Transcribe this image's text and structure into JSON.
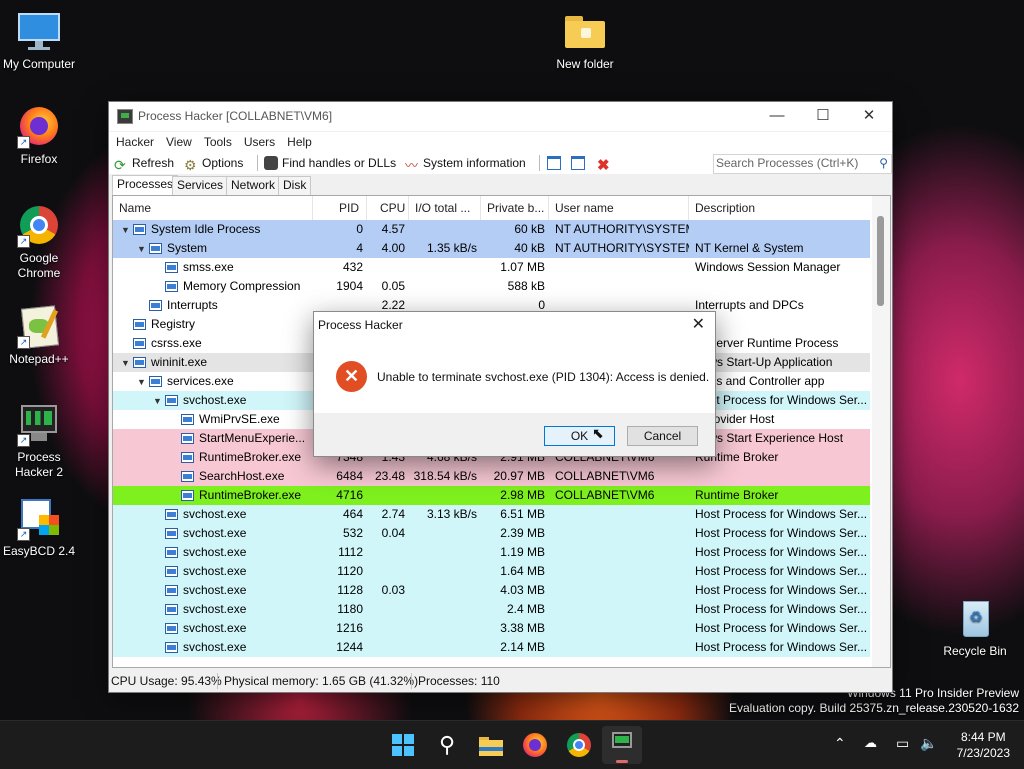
{
  "desktop": {
    "icons": [
      {
        "label": "My Computer",
        "icon": "monitor-icon"
      },
      {
        "label": "New folder",
        "icon": "folder-icon"
      },
      {
        "label": "Firefox",
        "icon": "firefox-icon"
      },
      {
        "label": "Google\nChrome",
        "icon": "chrome-icon"
      },
      {
        "label": "Notepad++",
        "icon": "notepadpp-icon"
      },
      {
        "label": "Process\nHacker 2",
        "icon": "process-hacker-icon"
      },
      {
        "label": "EasyBCD 2.4",
        "icon": "easybcd-icon"
      },
      {
        "label": "Recycle Bin",
        "icon": "recycle-bin-icon"
      }
    ],
    "watermark": {
      "line1": "Windows 11 Pro Insider Preview",
      "line2": "Evaluation copy. Build 25375.zn_release.230520-1632"
    }
  },
  "window": {
    "title": "Process Hacker [COLLABNET\\VM6]",
    "menu": [
      "Hacker",
      "View",
      "Tools",
      "Users",
      "Help"
    ],
    "toolbar": {
      "refresh": "Refresh",
      "options": "Options",
      "find_handles": "Find handles or DLLs",
      "system_information": "System information"
    },
    "search_placeholder": "Search Processes (Ctrl+K)",
    "tabs": [
      "Processes",
      "Services",
      "Network",
      "Disk"
    ],
    "columns": [
      "Name",
      "PID",
      "CPU",
      "I/O total ...",
      "Private b...",
      "User name",
      "Description"
    ],
    "rows": [
      {
        "indent": 0,
        "exp": "v",
        "name": "System Idle Process",
        "pid": "0",
        "cpu": "4.57",
        "io": "",
        "priv": "60 kB",
        "user": "NT AUTHORITY\\SYSTEM",
        "desc": "",
        "bg": "#b3cdf5",
        "hidden": false
      },
      {
        "indent": 1,
        "exp": "v",
        "name": "System",
        "pid": "4",
        "cpu": "4.00",
        "io": "1.35 kB/s",
        "priv": "40 kB",
        "user": "NT AUTHORITY\\SYSTEM",
        "desc": "NT Kernel & System",
        "bg": "#b3cdf5",
        "hidden": false
      },
      {
        "indent": 2,
        "exp": "",
        "name": "smss.exe",
        "pid": "432",
        "cpu": "",
        "io": "",
        "priv": "1.07 MB",
        "user": "",
        "desc": "Windows Session Manager",
        "bg": "#ffffff",
        "hidden": false
      },
      {
        "indent": 2,
        "exp": "",
        "name": "Memory Compression",
        "pid": "1904",
        "cpu": "0.05",
        "io": "",
        "priv": "588 kB",
        "user": "",
        "desc": "",
        "bg": "#ffffff",
        "hidden": false
      },
      {
        "indent": 1,
        "exp": "",
        "name": "Interrupts",
        "pid": "",
        "cpu": "2.22",
        "io": "",
        "priv": "0",
        "user": "",
        "desc": "Interrupts and DPCs",
        "bg": "#ffffff",
        "hidden": false
      },
      {
        "indent": 0,
        "exp": "",
        "name": "Registry",
        "pid": "",
        "cpu": "",
        "io": "",
        "priv": "",
        "user": "",
        "desc": "",
        "bg": "#ffffff",
        "hidden": true
      },
      {
        "indent": 0,
        "exp": "",
        "name": "csrss.exe",
        "pid": "",
        "cpu": "",
        "io": "",
        "priv": "",
        "user": "",
        "desc": "nt Server Runtime Process",
        "bg": "#ffffff",
        "hidden": true
      },
      {
        "indent": 0,
        "exp": "v",
        "name": "wininit.exe",
        "pid": "",
        "cpu": "",
        "io": "",
        "priv": "",
        "user": "",
        "desc": "dows Start-Up Application",
        "bg": "#e4e4e4",
        "hidden": true
      },
      {
        "indent": 1,
        "exp": "v",
        "name": "services.exe",
        "pid": "",
        "cpu": "",
        "io": "",
        "priv": "",
        "user": "",
        "desc": "vices and Controller app",
        "bg": "#ffffff",
        "hidden": true
      },
      {
        "indent": 2,
        "exp": "v",
        "name": "svchost.exe",
        "pid": "",
        "cpu": "",
        "io": "",
        "priv": "",
        "user": "",
        "desc": "Host Process for Windows Ser...",
        "bg": "#d0f6fa",
        "hidden": true
      },
      {
        "indent": 3,
        "exp": "",
        "name": "WmiPrvSE.exe",
        "pid": "",
        "cpu": "",
        "io": "",
        "priv": "",
        "user": "",
        "desc": "I Provider Host",
        "bg": "#ffffff",
        "hidden": true
      },
      {
        "indent": 3,
        "exp": "",
        "name": "StartMenuExperie...",
        "pid": "",
        "cpu": "",
        "io": "",
        "priv": "",
        "user": "",
        "desc": "dows Start Experience Host",
        "bg": "#f7c8d4",
        "hidden": true
      },
      {
        "indent": 3,
        "exp": "",
        "name": "RuntimeBroker.exe",
        "pid": "7348",
        "cpu": "1.43",
        "io": "4.68 kB/s",
        "priv": "2.91 MB",
        "user": "COLLABNET\\VM6",
        "desc": "Runtime Broker",
        "bg": "#f7c8d4",
        "hidden": false
      },
      {
        "indent": 3,
        "exp": "",
        "name": "SearchHost.exe",
        "pid": "6484",
        "cpu": "23.48",
        "io": "318.54 kB/s",
        "priv": "20.97 MB",
        "user": "COLLABNET\\VM6",
        "desc": "",
        "bg": "#f7c8d4",
        "hidden": false
      },
      {
        "indent": 3,
        "exp": "",
        "name": "RuntimeBroker.exe",
        "pid": "4716",
        "cpu": "",
        "io": "",
        "priv": "2.98 MB",
        "user": "COLLABNET\\VM6",
        "desc": "Runtime Broker",
        "bg": "#7ef01e",
        "hidden": false
      },
      {
        "indent": 2,
        "exp": "",
        "name": "svchost.exe",
        "pid": "464",
        "cpu": "2.74",
        "io": "3.13 kB/s",
        "priv": "6.51 MB",
        "user": "",
        "desc": "Host Process for Windows Ser...",
        "bg": "#d0f6fa",
        "hidden": false
      },
      {
        "indent": 2,
        "exp": "",
        "name": "svchost.exe",
        "pid": "532",
        "cpu": "0.04",
        "io": "",
        "priv": "2.39 MB",
        "user": "",
        "desc": "Host Process for Windows Ser...",
        "bg": "#d0f6fa",
        "hidden": false
      },
      {
        "indent": 2,
        "exp": "",
        "name": "svchost.exe",
        "pid": "1112",
        "cpu": "",
        "io": "",
        "priv": "1.19 MB",
        "user": "",
        "desc": "Host Process for Windows Ser...",
        "bg": "#d0f6fa",
        "hidden": false
      },
      {
        "indent": 2,
        "exp": "",
        "name": "svchost.exe",
        "pid": "1120",
        "cpu": "",
        "io": "",
        "priv": "1.64 MB",
        "user": "",
        "desc": "Host Process for Windows Ser...",
        "bg": "#d0f6fa",
        "hidden": false
      },
      {
        "indent": 2,
        "exp": "",
        "name": "svchost.exe",
        "pid": "1128",
        "cpu": "0.03",
        "io": "",
        "priv": "4.03 MB",
        "user": "",
        "desc": "Host Process for Windows Ser...",
        "bg": "#d0f6fa",
        "hidden": false
      },
      {
        "indent": 2,
        "exp": "",
        "name": "svchost.exe",
        "pid": "1180",
        "cpu": "",
        "io": "",
        "priv": "2.4 MB",
        "user": "",
        "desc": "Host Process for Windows Ser...",
        "bg": "#d0f6fa",
        "hidden": false
      },
      {
        "indent": 2,
        "exp": "",
        "name": "svchost.exe",
        "pid": "1216",
        "cpu": "",
        "io": "",
        "priv": "3.38 MB",
        "user": "",
        "desc": "Host Process for Windows Ser...",
        "bg": "#d0f6fa",
        "hidden": false
      },
      {
        "indent": 2,
        "exp": "",
        "name": "svchost.exe",
        "pid": "1244",
        "cpu": "",
        "io": "",
        "priv": "2.14 MB",
        "user": "",
        "desc": "Host Process for Windows Ser...",
        "bg": "#d0f6fa",
        "hidden": false
      }
    ],
    "status": {
      "cpu": "CPU Usage: 95.43%",
      "memory": "Physical memory: 1.65 GB (41.32%)",
      "processes": "Processes: 110"
    }
  },
  "dialog": {
    "title": "Process Hacker",
    "message": "Unable to terminate svchost.exe (PID 1304): Access is denied.",
    "ok": "OK",
    "cancel": "Cancel"
  },
  "taskbar": {
    "apps": [
      "windows-start-icon",
      "search-icon",
      "file-explorer-icon",
      "firefox-icon",
      "chrome-icon",
      "process-hacker-icon"
    ],
    "time": "8:44 PM",
    "date": "7/23/2023"
  }
}
